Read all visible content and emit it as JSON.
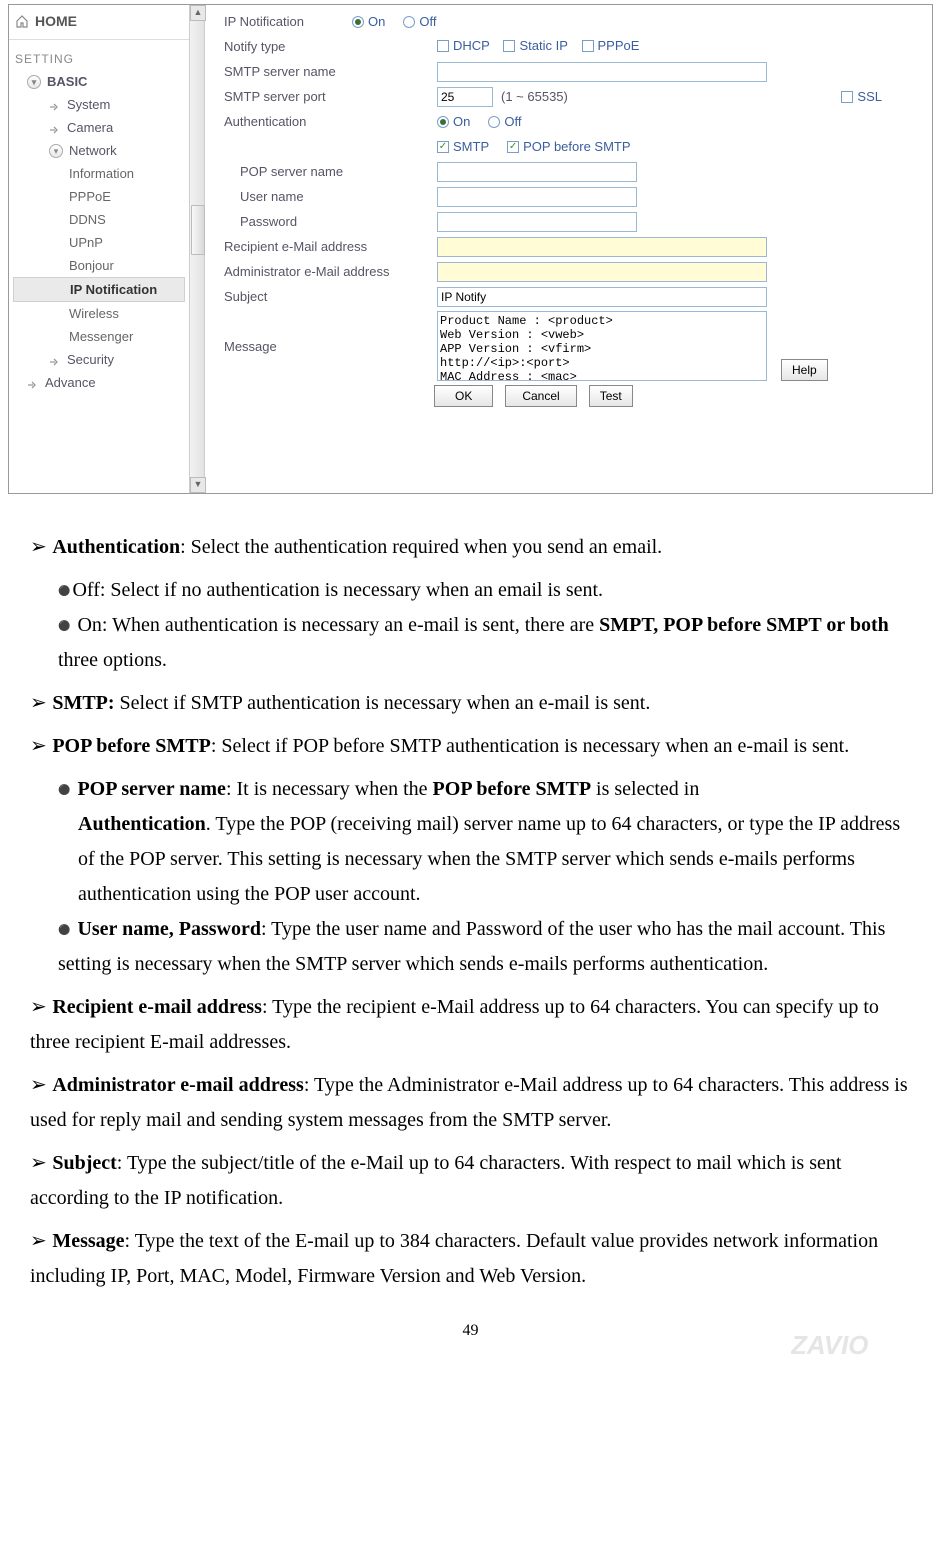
{
  "nav": {
    "home": "HOME",
    "setting_header": "SETTING",
    "basic": "BASIC",
    "system": "System",
    "camera": "Camera",
    "network": "Network",
    "subs": {
      "information": "Information",
      "pppoe": "PPPoE",
      "ddns": "DDNS",
      "upnp": "UPnP",
      "bonjour": "Bonjour",
      "ipnotif": "IP Notification",
      "wireless": "Wireless",
      "messenger": "Messenger"
    },
    "security": "Security",
    "advance": "Advance"
  },
  "form": {
    "ip_notification_label": "IP Notification",
    "on": "On",
    "off": "Off",
    "notify_type": "Notify type",
    "dhcp": "DHCP",
    "static_ip": "Static IP",
    "pppoe": "PPPoE",
    "smtp_server_name": "SMTP server name",
    "smtp_server_port": "SMTP server port",
    "port_value": "25",
    "port_range": "(1 ~ 65535)",
    "ssl": "SSL",
    "authentication": "Authentication",
    "smtp_cb": "SMTP",
    "pop_before_smtp": "POP before SMTP",
    "pop_server_name": "POP server name",
    "user_name": "User name",
    "password": "Password",
    "recipient": "Recipient e-Mail address",
    "admin": "Administrator e-Mail address",
    "subject": "Subject",
    "subject_value": "IP Notify",
    "message": "Message",
    "message_value": "Product Name : <product>\nWeb Version : <vweb>\nAPP Version : <vfirm>\nhttp://<ip>:<port>\nMAC Address : <mac>",
    "help": "Help",
    "ok": "OK",
    "cancel": "Cancel",
    "test": "Test"
  },
  "doc": {
    "auth_title": "Authentication",
    "auth_text": ": Select the authentication required when you send an email.",
    "auth_off": "Off: Select if no authentication is necessary when an email is sent.",
    "auth_on_pre": "On: When authentication is necessary an e-mail is sent, there are ",
    "auth_on_bold": "SMPT, POP before SMPT or both",
    "auth_on_post": " three options.",
    "smtp_title": "SMTP:",
    "smtp_text": " Select if SMTP authentication is necessary when an e-mail is sent.",
    "popb4_title": "POP before SMTP",
    "popb4_text": ": Select if POP before SMTP authentication is necessary when an e-mail is sent.",
    "popsrv_title": "POP server name",
    "popsrv_text1": ": It is necessary when the ",
    "popsrv_bold1": "POP before SMTP",
    "popsrv_text2": " is selected in ",
    "popsrv_bold2": "Authentication",
    "popsrv_text3": ". Type the POP (receiving mail) server name up to 64 characters, or type the IP address of the POP server. This setting is necessary when the SMTP server which sends e-mails performs authentication using the POP user account.",
    "userpw_title": "User name, Password",
    "userpw_text": ": Type the user name and Password of the user who has the mail account. This setting is necessary when the SMTP server which sends e-mails performs authentication.",
    "recip_title": "Recipient e-mail address",
    "recip_text": ": Type the recipient e-Mail address up to 64 characters. You can specify up to three recipient E-mail addresses.",
    "admin_title": "Administrator e-mail address",
    "admin_text": ": Type the Administrator e-Mail address up to 64 characters. This address is used for reply mail and sending system messages from the SMTP server.",
    "subj_title": "Subject",
    "subj_text": ": Type the subject/title of the e-Mail up to 64 characters. With respect to mail which is sent according to the IP notification.",
    "msg_title": "Message",
    "msg_text": ": Type the text of the E-mail up to 384 characters. Default value provides network information including IP, Port, MAC, Model, Firmware Version and Web Version.",
    "page": "49"
  }
}
